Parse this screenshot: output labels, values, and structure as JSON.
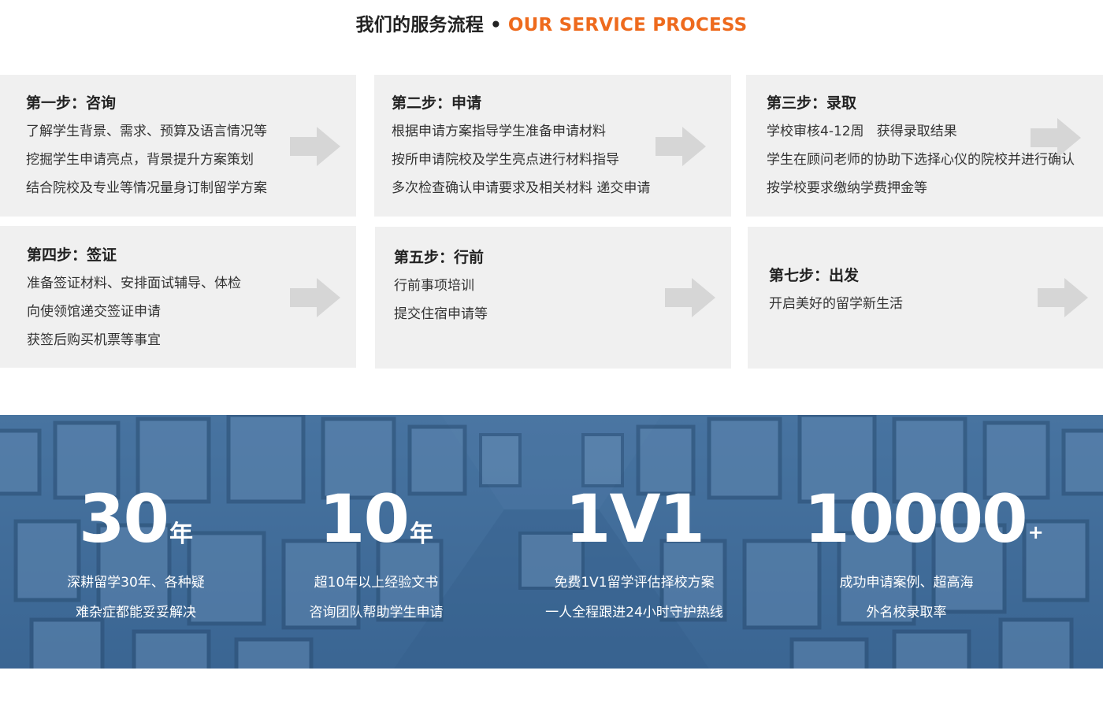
{
  "header": {
    "title_cn": "我们的服务流程",
    "separator": "•",
    "title_en": "OUR SERVICE PROCESS"
  },
  "steps": [
    {
      "title": "第一步：咨询",
      "lines": [
        "了解学生背景、需求、预算及语言情况等",
        "挖掘学生申请亮点，背景提升方案策划",
        "结合院校及专业等情况量身订制留学方案"
      ]
    },
    {
      "title": "第二步：申请",
      "lines": [
        "根据申请方案指导学生准备申请材料",
        "按所申请院校及学生亮点进行材料指导",
        "多次检查确认申请要求及相关材料 递交申请"
      ]
    },
    {
      "title": "第三步：录取",
      "lines": [
        "学校审核4-12周   获得录取结果",
        "学生在顾问老师的协助下选择心仪的院校并进行确认",
        "按学校要求缴纳学费押金等"
      ]
    },
    {
      "title": "第四步：签证",
      "lines": [
        "准备签证材料、安排面试辅导、体检",
        "向使领馆递交签证申请",
        "获签后购买机票等事宜"
      ]
    },
    {
      "title": "第五步：行前",
      "lines": [
        "行前事项培训",
        "提交住宿申请等"
      ]
    },
    {
      "title": "第七步：出发",
      "lines": [
        "开启美好的留学新生活"
      ]
    }
  ],
  "stats": [
    {
      "number": "30",
      "unit": "年",
      "desc": [
        "深耕留学30年、各种疑",
        "难杂症都能妥妥解决"
      ]
    },
    {
      "number": "10",
      "unit": "年",
      "desc": [
        "超10年以上经验文书",
        "咨询团队帮助学生申请"
      ]
    },
    {
      "number": "1V1",
      "unit": "",
      "desc": [
        "免费1V1留学评估择校方案",
        "一人全程跟进24小时守护热线"
      ]
    },
    {
      "number": "10000",
      "unit": "+",
      "desc": [
        "成功申请案例、超高海",
        "外名校录取率"
      ]
    }
  ],
  "colors": {
    "accent": "#ee6a1d",
    "card_bg": "#f0f0f0",
    "arrow": "#d6d6d6",
    "band_blue": "#3f6c9a"
  },
  "icons": {
    "step_arrow": "right-arrow-icon"
  }
}
